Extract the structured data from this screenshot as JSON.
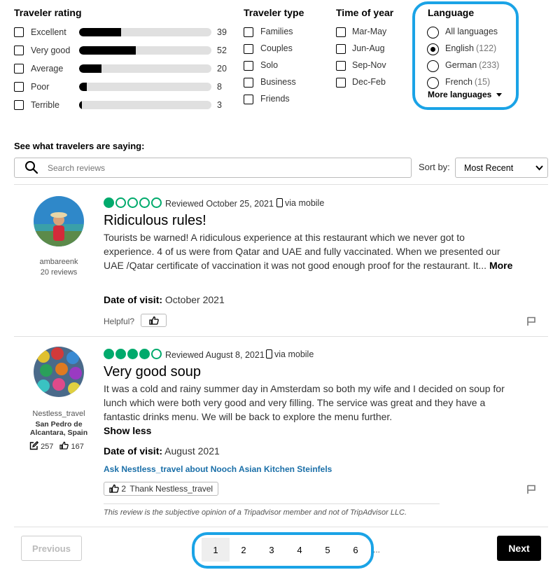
{
  "filters": {
    "traveler_rating": {
      "heading": "Traveler rating",
      "items": [
        {
          "label": "Excellent",
          "count": "39",
          "fraction": 0.32
        },
        {
          "label": "Very good",
          "count": "52",
          "fraction": 0.43
        },
        {
          "label": "Average",
          "count": "20",
          "fraction": 0.17
        },
        {
          "label": "Poor",
          "count": "8",
          "fraction": 0.06
        },
        {
          "label": "Terrible",
          "count": "3",
          "fraction": 0.02
        }
      ]
    },
    "traveler_type": {
      "heading": "Traveler type",
      "items": [
        "Families",
        "Couples",
        "Solo",
        "Business",
        "Friends"
      ]
    },
    "time_of_year": {
      "heading": "Time of year",
      "items": [
        "Mar-May",
        "Jun-Aug",
        "Sep-Nov",
        "Dec-Feb"
      ]
    },
    "language": {
      "heading": "Language",
      "items": [
        {
          "label": "All languages",
          "count": "",
          "checked": false
        },
        {
          "label": "English",
          "count": "(122)",
          "checked": true
        },
        {
          "label": "German",
          "count": "(233)",
          "checked": false
        },
        {
          "label": "French",
          "count": "(15)",
          "checked": false
        }
      ],
      "more": "More languages"
    }
  },
  "section_title": "See what travelers are saying:",
  "search": {
    "placeholder": "Search reviews"
  },
  "sort": {
    "label": "Sort by:",
    "value": "Most Recent"
  },
  "reviews": [
    {
      "username": "ambareenk",
      "reviews_count": "20 reviews",
      "rating": 1,
      "reviewed": "Reviewed October 25, 2021",
      "via": "via mobile",
      "title": "Ridiculous rules!",
      "body": "Tourists be warned! A ridiculous experience at this restaurant which we never got to experience. 4 of us were from Qatar and UAE and fully vaccinated. When we presented our UAE /Qatar certificate of vaccination it was not good enough proof for the restaurant. It...",
      "more": "More",
      "date_label": "Date of visit:",
      "date_value": "October 2021",
      "helpful": "Helpful?"
    },
    {
      "username": "Nestless_travel",
      "location": "San Pedro de Alcantara, Spain",
      "contributions": "257",
      "helpful_votes": "167",
      "rating": 4,
      "reviewed": "Reviewed August 8, 2021",
      "via": "via mobile",
      "title": "Very good soup",
      "body": "It was a cold and rainy summer day in Amsterdam so both my wife and I decided on soup for lunch which were both very good and very filling. The service was great and they have a fantastic drinks menu. We will be back to explore the menu further.",
      "show_less": "Show less",
      "date_label": "Date of visit:",
      "date_value": "August 2021",
      "ask": "Ask Nestless_travel about Nooch Asian Kitchen Steinfels",
      "thanks_count": "2",
      "thanks_label": "Thank Nestless_travel",
      "disclaimer": "This review is the subjective opinion of a Tripadvisor member and not of TripAdvisor LLC."
    }
  ],
  "pagination": {
    "previous": "Previous",
    "next": "Next",
    "pages": [
      "1",
      "2",
      "3",
      "4",
      "5",
      "6"
    ],
    "ellipsis": "...",
    "current": "1"
  },
  "colors": {
    "rating_green": "#00aa6c",
    "highlight_blue": "#1aa3e6",
    "link_blue": "#1a6fa8"
  }
}
